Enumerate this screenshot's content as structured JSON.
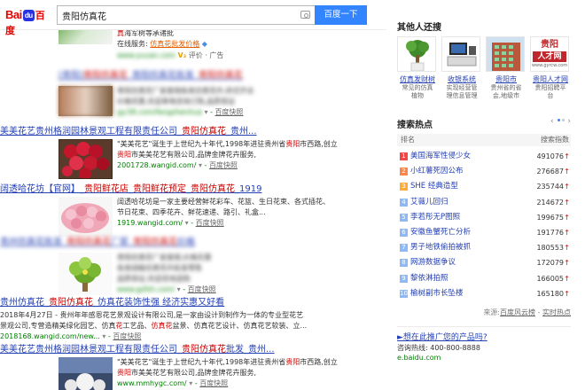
{
  "header": {
    "logo_bai": "Bai",
    "logo_paw": "du",
    "logo_du": "百度",
    "search_value": "贵阳仿真花",
    "search_button": "百度一下"
  },
  "results": {
    "ad": {
      "line1_red": "真",
      "line1_rest": "海军树等承诸批",
      "line2_prefix": "在线服务:",
      "line2_orange": "仿真花批发价格",
      "url": "www.yuuan.com",
      "vip": "V",
      "ad_suffix": "评价 · 广告"
    },
    "blurred1": {
      "title_prefix": "[贵阳]",
      "title_red": "贵阳仿真花",
      "title_mid": "_贵阳仿真花批发_",
      "title_red2": "贵阳仿真花",
      "text1": "贵阳仿真花厂家直销各类仿真花卉,样式齐全",
      "text2": "价格优惠,欢迎来电咨询订购,品质保证",
      "url": "gy.58.com/fangzhenhua",
      "snapshot": "百度快照"
    },
    "r1": {
      "title_a": "美美花艺贵州格润园林景观工程有限责任公司_",
      "title_red": "贵阳仿真花",
      "title_b": "_贵州...",
      "text1": "\"美美花艺\"诞生于上世纪九十年代,1998年进驻贵州省",
      "text1_red": "贵阳",
      "text1_b": "市西路,创立",
      "text2_red": "贵阳",
      "text2_b": "市美美花艺有限公司,品牌金牌花卉服务,",
      "url": "2001728.wangid.com/",
      "snapshot": "百度快照"
    },
    "r2": {
      "title_a": "阔透哈花坊【官网】_",
      "title_red": "贵阳鲜花店",
      "title_b": "_",
      "title_red2": "贵阳鲜花预定",
      "title_c": "_",
      "title_red3": "贵阳仿真花",
      "title_d": "_1919",
      "text1": "阔透哈花坊是一家主要经营鲜花彩车、花篮、生日花束、各式插花、",
      "text2": "节日花束、四季花卉、鲜花速递、路引、礼盒...",
      "url": "1919.wangid.com/",
      "snapshot": "百度快照"
    },
    "blurred2": {
      "title_a": "贵州仿真花批发_",
      "title_red": "贵阳仿真花",
      "title_b": "厂家_",
      "title_red2": "贵阳仿真花",
      "title_c": "价格",
      "text1": "贵阳仿真花厂家直销,价格实惠",
      "text2": "各类绿植仿真花卉批发零售",
      "text3": "品质保证,欢迎咨询选购",
      "url": "www.gzfzh.com/",
      "snapshot": "百度快照"
    },
    "r3": {
      "title_a": "贵州仿真花_",
      "title_red": "贵阳仿真花",
      "title_b": "_仿真花装饰性强 经济实惠又好看",
      "text1": "2018年4月27日 - 贵州年年感恩花艺景观设计有限公司,是一家由设计到制作为一体的专业型花艺",
      "text2": "景观公司,专营造精美绿化园艺、仿真",
      "text2_red": "花",
      "text2_b": "工艺品、",
      "text2_red2": "仿真花",
      "text2_c": "盆景、仿真花艺设计、仿真花艺软装、立...",
      "url": "2018168.wangid.com/new...",
      "snapshot": "百度快照"
    },
    "r4": {
      "title_a": "美美花艺贵州格润园林景观工程有限责任公司_",
      "title_red": "贵阳仿真花",
      "title_b": "批发_贵州...",
      "text1": "\"美美花艺\"诞生于上世纪九十年代,1998年进驻贵州省",
      "text1_red": "贵阳",
      "text1_b": "市西路,创立",
      "text2_red": "贵阳",
      "text2_b": "市美美花艺有限公司,品牌金牌花卉服务,",
      "url": "www.mmhygc.com/",
      "snapshot": "百度快照"
    }
  },
  "sidebar": {
    "card_title": "其他人还搜",
    "cards": [
      {
        "caption": "仿真发财树",
        "sub1": "常见的仿真",
        "sub2": "植物"
      },
      {
        "caption": "收银系统",
        "sub1": "实现经营管",
        "sub2": "理信息管理"
      },
      {
        "caption": "贵阳市",
        "sub1": "贵州省的省",
        "sub2": "会,地级市"
      },
      {
        "caption": "贵阳人才网",
        "sub1": "贵阳招聘平",
        "sub2": "台"
      }
    ],
    "card4_logo1": "贵阳",
    "card4_logo2": "人才网",
    "card4_logo3": "www.gyrcw.com",
    "hot_title": "搜索热点",
    "nav_prev": "‹",
    "nav_next": "›",
    "col_name": "排名",
    "col_index": "搜索指数",
    "hot_items": [
      {
        "rank": "1",
        "name": "美国海军性侵少女",
        "num": "491076",
        "dir": "up"
      },
      {
        "rank": "2",
        "name": "小红薯死因公布",
        "num": "276687",
        "dir": "up"
      },
      {
        "rank": "3",
        "name": "SHE 经典造型",
        "num": "235744",
        "dir": "up"
      },
      {
        "rank": "4",
        "name": "艾薇儿回归",
        "num": "214672",
        "dir": "up"
      },
      {
        "rank": "5",
        "name": "李若彤无P图照",
        "num": "199675",
        "dir": "up"
      },
      {
        "rank": "6",
        "name": "安徽鱼蟹死亡分析",
        "num": "191776",
        "dir": "up"
      },
      {
        "rank": "7",
        "name": "男子地铁偷拍被抓",
        "num": "180553",
        "dir": "up"
      },
      {
        "rank": "8",
        "name": "网游数据争议",
        "num": "172079",
        "dir": "up"
      },
      {
        "rank": "9",
        "name": "黎依淋拍照",
        "num": "166005",
        "dir": "up"
      },
      {
        "rank": "10",
        "name": "榆树副市长坠楼",
        "num": "165180",
        "dir": "up"
      }
    ],
    "source_label": "来源:",
    "source_link1": "百度风云榜",
    "source_sep": " - ",
    "source_link2": "实时热点",
    "promo_link": "►想在此推广您的产品吗?",
    "promo_consult": "咨询热线: 400-800-8888",
    "promo_domain": "e.baidu.com"
  },
  "colors": {
    "accent": "#3385ff",
    "link": "#2440b3",
    "highlight": "#cc0000",
    "url": "#008000"
  }
}
